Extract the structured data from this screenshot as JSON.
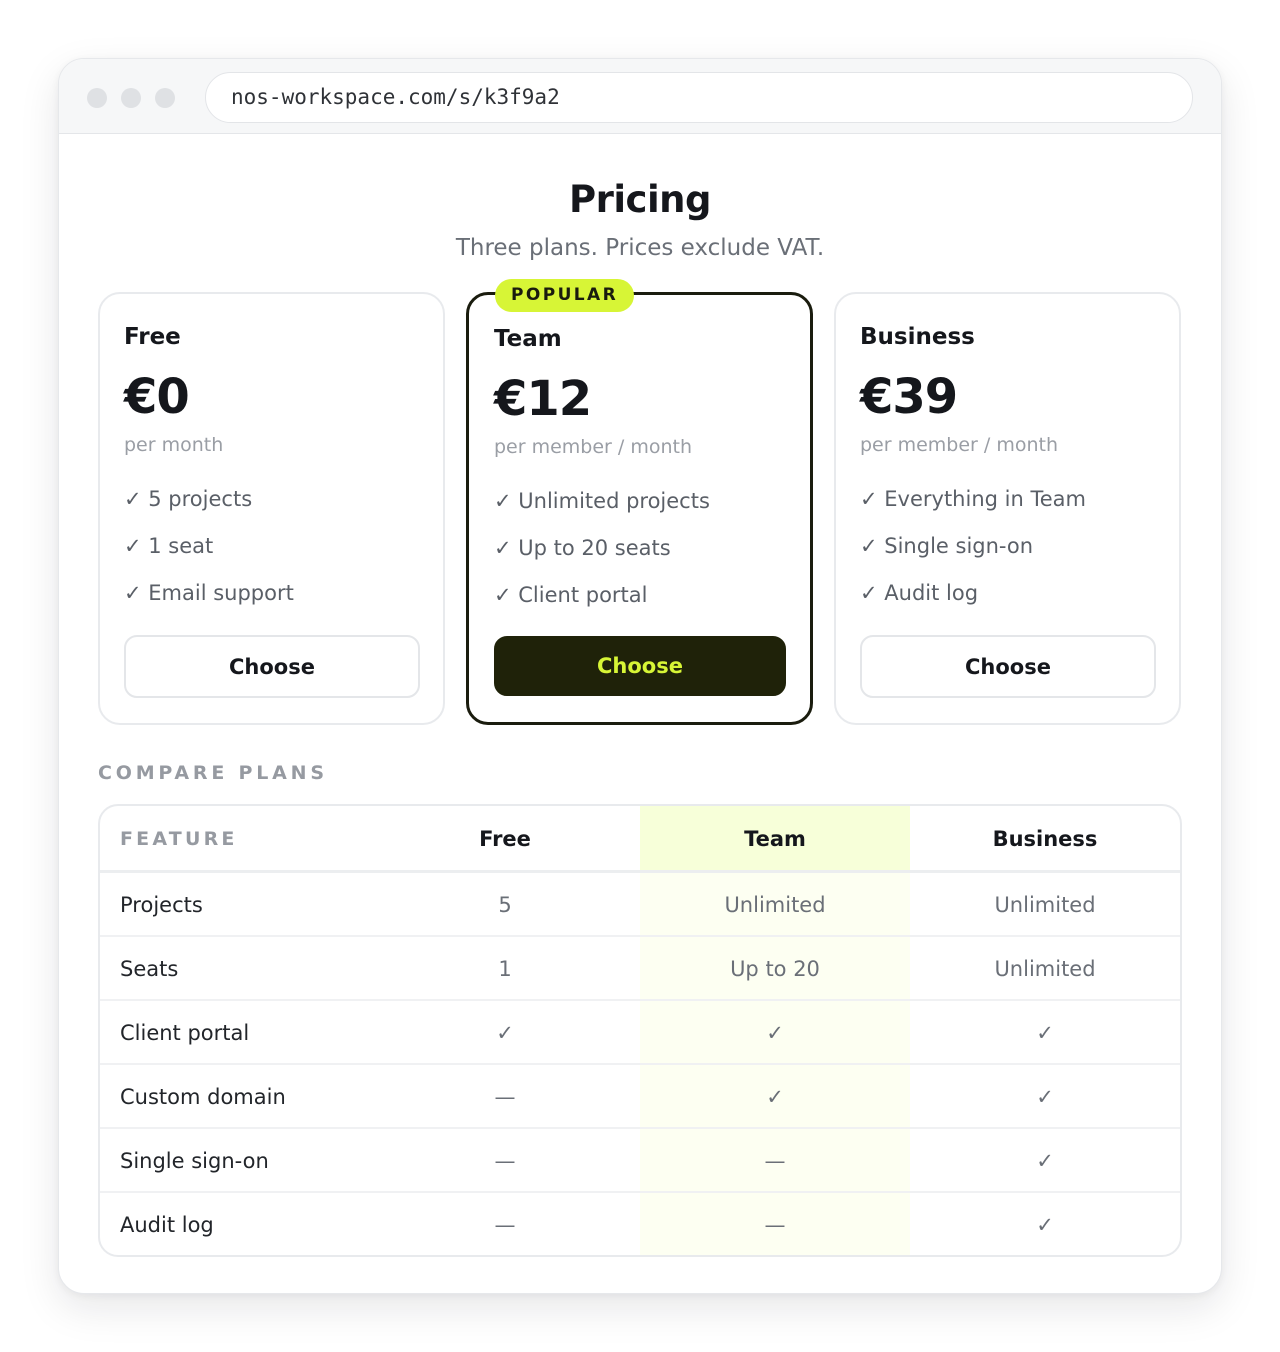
{
  "browser": {
    "url": "nos-workspace.com/s/k3f9a2"
  },
  "header": {
    "title": "Pricing",
    "subtitle": "Three plans. Prices exclude VAT."
  },
  "colors": {
    "accent": "#d7f536",
    "dark": "#1f2209"
  },
  "plans": [
    {
      "name": "Free",
      "price": "€0",
      "unit": "per month",
      "features": [
        "✓ 5 projects",
        "✓ 1 seat",
        "✓ Email support"
      ],
      "cta": "Choose"
    },
    {
      "name": "Team",
      "badge": "POPULAR",
      "price": "€12",
      "unit": "per member / month",
      "features": [
        "✓ Unlimited projects",
        "✓ Up to 20 seats",
        "✓ Client portal"
      ],
      "cta": "Choose"
    },
    {
      "name": "Business",
      "price": "€39",
      "unit": "per member / month",
      "features": [
        "✓ Everything in Team",
        "✓ Single sign-on",
        "✓ Audit log"
      ],
      "cta": "Choose"
    }
  ],
  "compare": {
    "heading": "COMPARE PLANS",
    "columns": [
      "FEATURE",
      "Free",
      "Team",
      "Business"
    ],
    "rows": [
      [
        "Projects",
        "5",
        "Unlimited",
        "Unlimited"
      ],
      [
        "Seats",
        "1",
        "Up to 20",
        "Unlimited"
      ],
      [
        "Client portal",
        "✓",
        "✓",
        "✓"
      ],
      [
        "Custom domain",
        "—",
        "✓",
        "✓"
      ],
      [
        "Single sign-on",
        "—",
        "—",
        "✓"
      ],
      [
        "Audit log",
        "—",
        "—",
        "✓"
      ]
    ]
  }
}
